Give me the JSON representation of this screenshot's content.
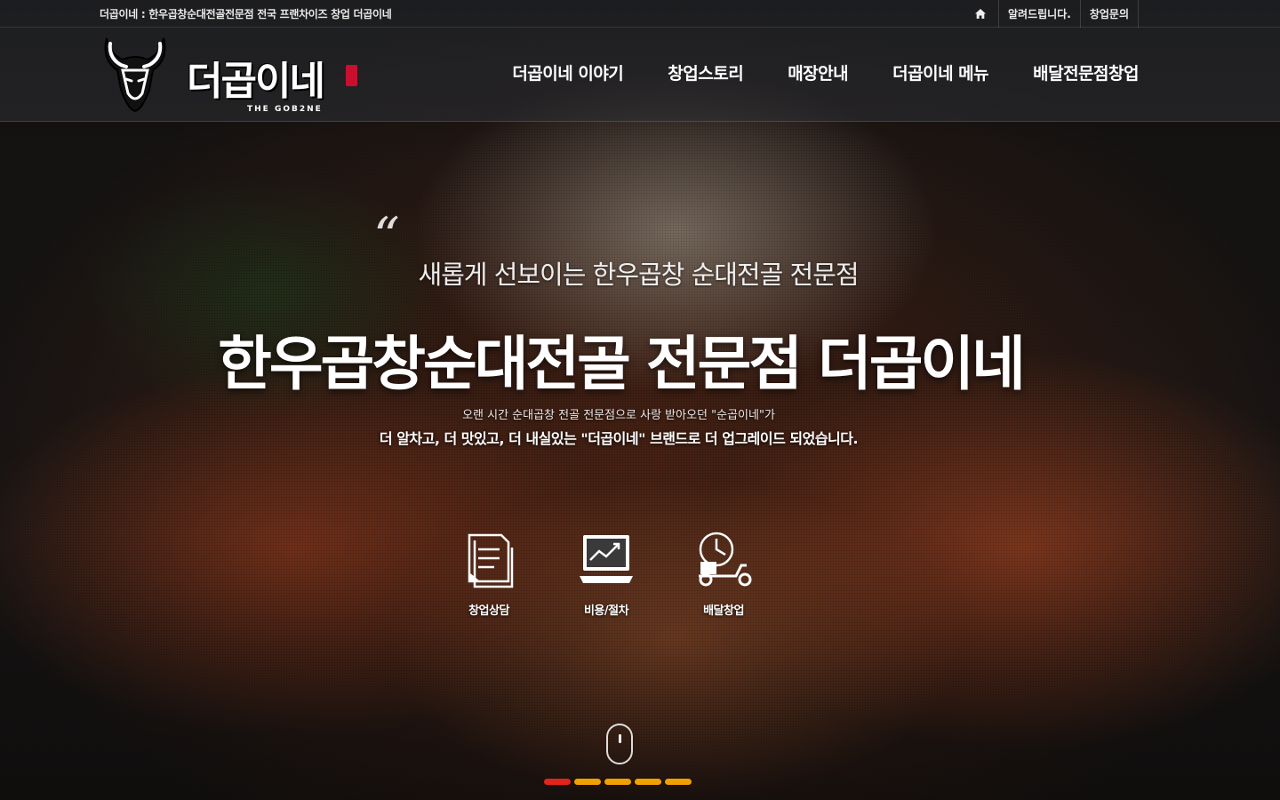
{
  "topbar": {
    "title": "더곱이네 : 한우곱창순대전골전문점 전국 프랜차이즈 창업 더곱이네",
    "links": [
      "알려드립니다.",
      "창업문의"
    ]
  },
  "header": {
    "logo_text": "더곱이네",
    "logo_sub": "THE GOB2NE",
    "nav": [
      "더곱이네 이야기",
      "창업스토리",
      "매장안내",
      "더곱이네 메뉴",
      "배달전문점창업"
    ]
  },
  "hero": {
    "quote": "“",
    "subtitle": "새롭게 선보이는 한우곱창 순대전골 전문점",
    "title": "한우곱창순대전골 전문점 더곱이네",
    "desc_line1": "오랜 시간 순대곱창 전골 전문점으로 사랑 받아오던 \"순곱이네\"가",
    "desc_line2": "더 알차고, 더 맛있고, 더 내실있는 \"더곱이네\" 브랜드로 더 업그레이드 되었습니다."
  },
  "quick_menu": [
    {
      "label": "창업상담",
      "icon": "document-icon"
    },
    {
      "label": "비용/절차",
      "icon": "laptop-chart-icon"
    },
    {
      "label": "배달창업",
      "icon": "delivery-scooter-icon"
    }
  ],
  "pager": {
    "count": 5,
    "active_index": 0,
    "active_color": "#e3241b",
    "inactive_color": "#f0a000"
  }
}
